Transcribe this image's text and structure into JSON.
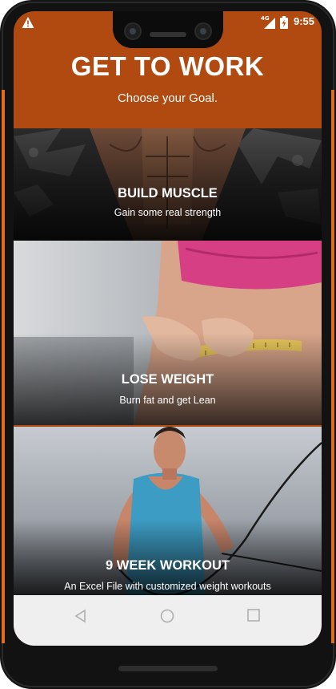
{
  "status_bar": {
    "time": "9:55",
    "network": "4G",
    "icons": [
      "warning-icon",
      "signal-icon",
      "battery-charging-icon"
    ]
  },
  "header": {
    "title": "GET TO WORK",
    "subtitle": "Choose your Goal.",
    "background_color": "#b04a10"
  },
  "goals": [
    {
      "title": "BUILD MUSCLE",
      "description": "Gain some real strength"
    },
    {
      "title": "LOSE WEIGHT",
      "description": "Burn fat and get Lean"
    },
    {
      "title": "9 WEEK WORKOUT",
      "description": "An Excel File with customized weight workouts"
    }
  ],
  "nav_bar": {
    "icons": [
      "back-icon",
      "home-icon",
      "recent-apps-icon"
    ]
  },
  "colors": {
    "accent": "#e06d1d",
    "frame": "#121212"
  }
}
